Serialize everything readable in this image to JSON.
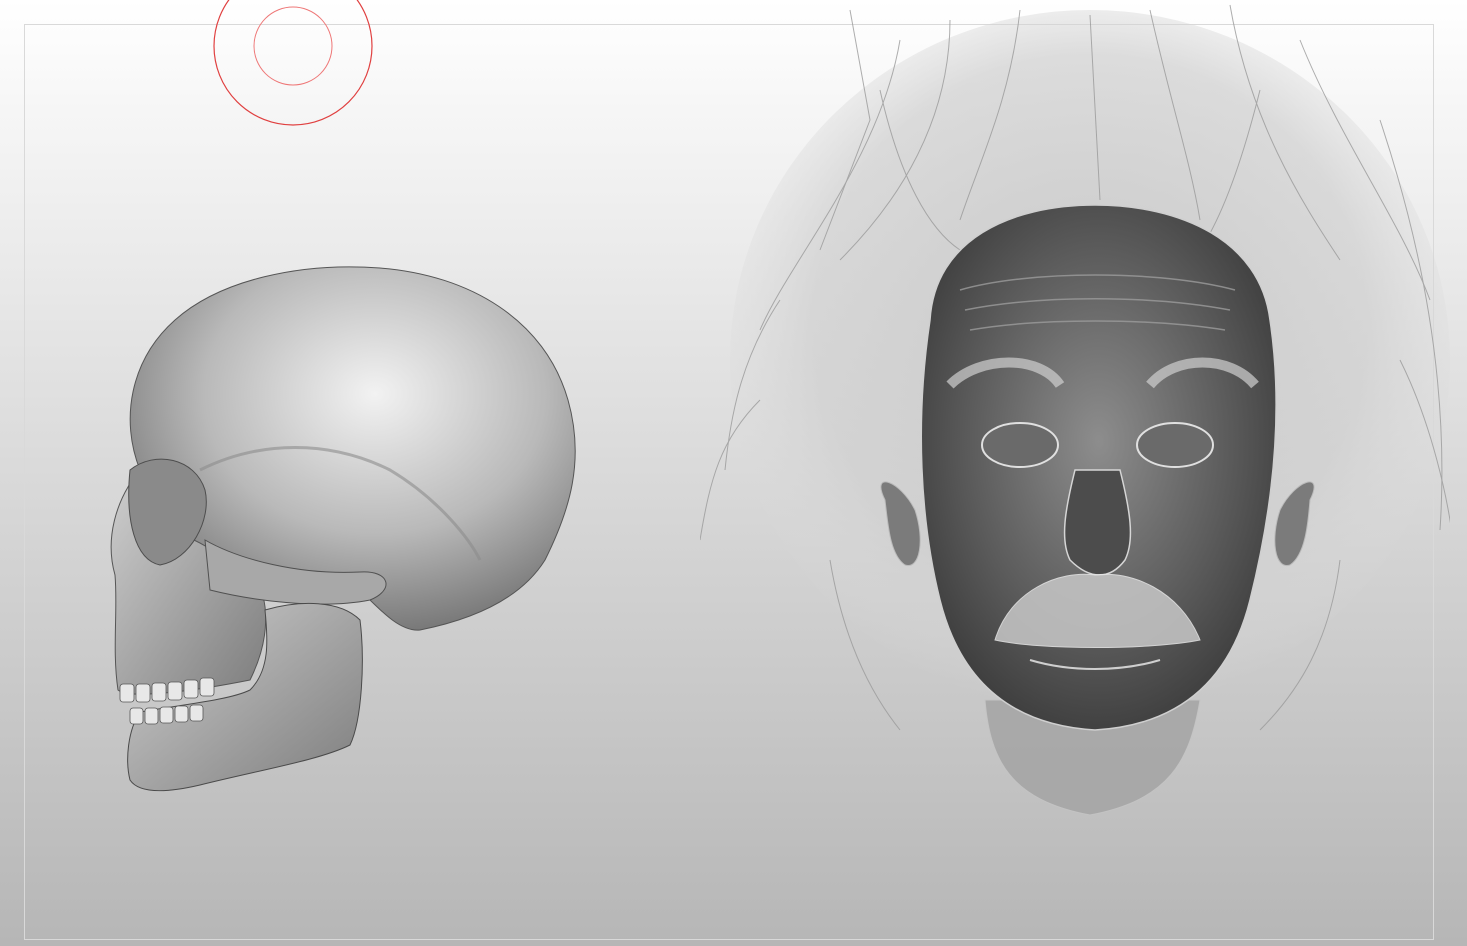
{
  "viewport": {
    "background_top": "#ffffff",
    "background_bottom": "#b6b6b6",
    "frame_color": "#d9d9d9"
  },
  "brush_cursor": {
    "icon": "brush-circle-icon",
    "color": "#e04040"
  },
  "models": [
    {
      "icon": "skull-mesh-icon",
      "view": "side"
    },
    {
      "icon": "head-hair-mesh-icon",
      "view": "front"
    }
  ]
}
